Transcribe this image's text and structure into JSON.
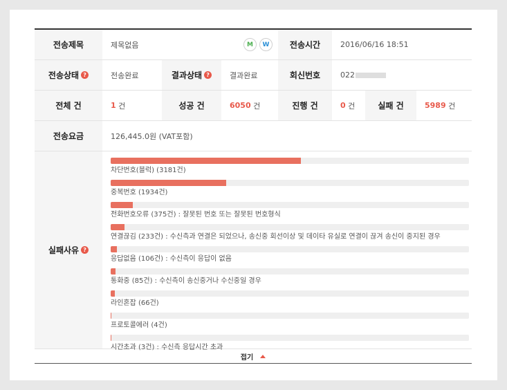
{
  "summary": {
    "title_label": "전송제목",
    "title_value": "제목없음",
    "badge_m": "M",
    "badge_w": "W",
    "time_label": "전송시간",
    "time_value": "2016/06/16 18:51",
    "status_label": "전송상태",
    "status_value": "전송완료",
    "result_label": "결과상태",
    "result_value": "결과완료",
    "reply_label": "회신번호",
    "reply_value": "022",
    "help_glyph": "?",
    "total_label": "전체 건",
    "total_count": "1",
    "success_label": "성공 건",
    "success_count": "6050",
    "progress_label": "진행 건",
    "progress_count": "0",
    "fail_label": "실패 건",
    "fail_count": "5989",
    "unit": "건",
    "fee_label": "전송요금",
    "fee_value": "126,445.0원 (VAT포함)",
    "reason_label": "실패사유"
  },
  "failure_reasons": [
    {
      "label": "차단번호(블럭) (3181건)",
      "count": 3181
    },
    {
      "label": "중복번호 (1934건)",
      "count": 1934
    },
    {
      "label": "전화번호오류 (375건) : 잘못된 번호 또는 잘못된 번호형식",
      "count": 375
    },
    {
      "label": "연결끊김 (233건) : 수신측과 연결은 되었으나, 송신중 회선이상 및 데이타 유실로 연결이 끊겨 송신이 중지된 경우",
      "count": 233
    },
    {
      "label": "응답없음 (106건) : 수신측이 응답이 없음",
      "count": 106
    },
    {
      "label": "통화중 (85건) : 수신측이 송신중거나 수신중일 경우",
      "count": 85
    },
    {
      "label": "라인혼잡 (66건)",
      "count": 66
    },
    {
      "label": "프로토콜에러 (4건)",
      "count": 4
    },
    {
      "label": "시간초과 (3건) : 수신측 응답시간 초과",
      "count": 3
    }
  ],
  "bar_scale_max": 5989,
  "fold_label": "접기",
  "colors": {
    "accent": "#e8594a",
    "bar": "#e8705f",
    "badge_m": "#4caf50",
    "badge_w": "#2a8fd6"
  }
}
